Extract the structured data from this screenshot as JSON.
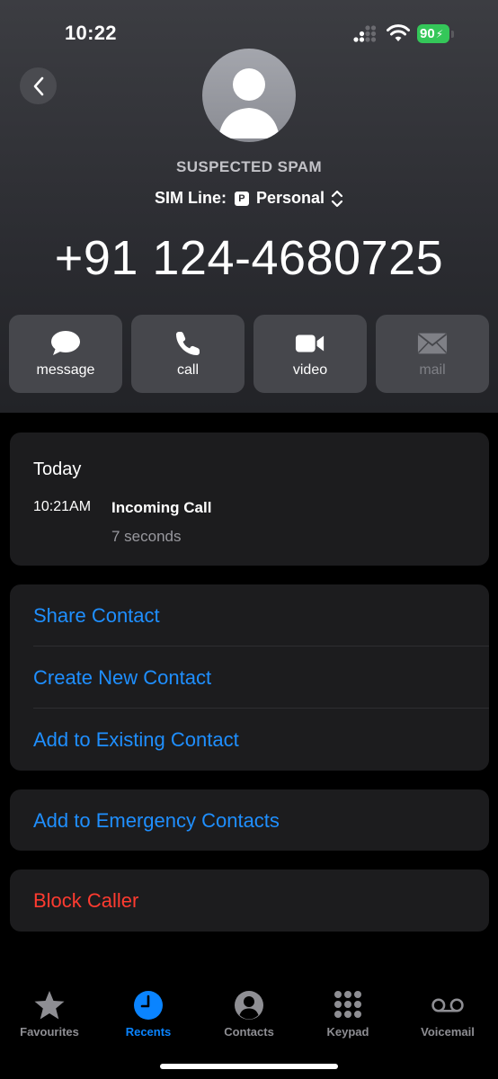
{
  "status_bar": {
    "time": "10:22",
    "battery": "90"
  },
  "contact": {
    "label": "SUSPECTED SPAM",
    "sim_prefix": "SIM Line:",
    "sim_badge": "P",
    "sim_name": "Personal",
    "number": "+91 124-4680725"
  },
  "actions": [
    {
      "label": "message",
      "icon": "message-icon"
    },
    {
      "label": "call",
      "icon": "phone-icon"
    },
    {
      "label": "video",
      "icon": "video-icon"
    },
    {
      "label": "mail",
      "icon": "mail-icon",
      "disabled": true
    }
  ],
  "call_log": {
    "day": "Today",
    "time": "10:21AM",
    "type": "Incoming Call",
    "duration": "7 seconds"
  },
  "options": {
    "share": "Share Contact",
    "create": "Create New Contact",
    "add_existing": "Add to Existing Contact",
    "emergency": "Add to Emergency Contacts",
    "block": "Block Caller"
  },
  "tabs": [
    {
      "label": "Favourites",
      "icon": "star-icon"
    },
    {
      "label": "Recents",
      "icon": "clock-icon",
      "active": true
    },
    {
      "label": "Contacts",
      "icon": "person-circle-icon"
    },
    {
      "label": "Keypad",
      "icon": "keypad-icon"
    },
    {
      "label": "Voicemail",
      "icon": "voicemail-icon"
    }
  ],
  "colors": {
    "accent": "#0a84ff",
    "link": "#1f8fff",
    "danger": "#ff3b30",
    "battery": "#34c759"
  }
}
